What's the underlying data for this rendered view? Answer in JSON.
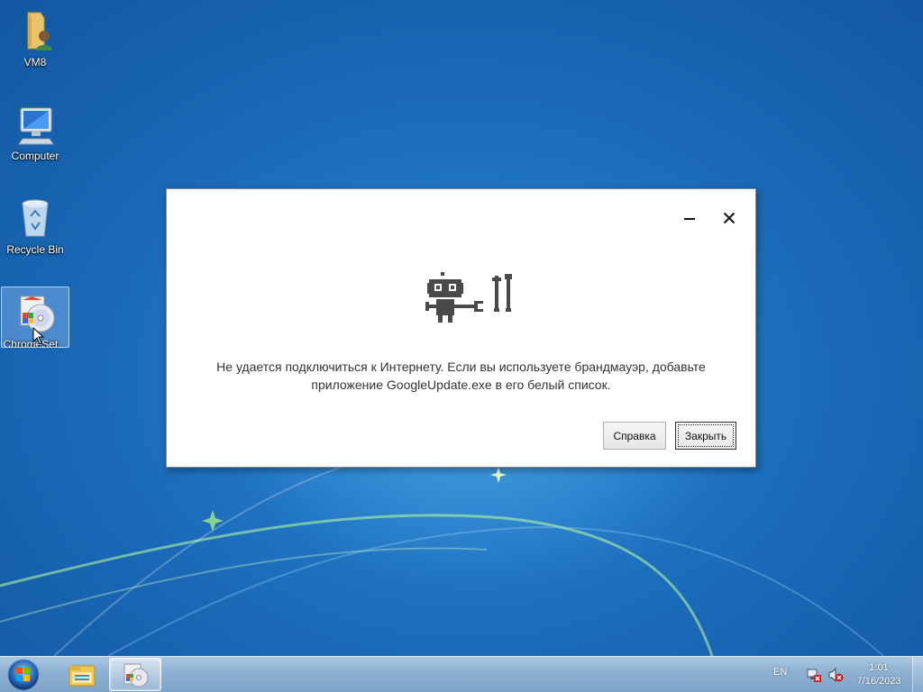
{
  "desktop": {
    "icons": [
      {
        "label": "VM8",
        "icon": "user-folder-icon"
      },
      {
        "label": "Computer",
        "icon": "computer-icon"
      },
      {
        "label": "Recycle Bin",
        "icon": "recycle-bin-icon"
      },
      {
        "label": "ChromeSet...",
        "icon": "setup-installer-icon",
        "selected": true
      }
    ]
  },
  "dialog": {
    "illustration": "offline-robot-icon",
    "message_line1": "Не удается подключиться к Интернету. Если вы используете брандмауэр, добавьте",
    "message_line2": "приложение GoogleUpdate.exe в его белый список.",
    "help_label": "Справка",
    "close_label": "Закрыть"
  },
  "taskbar": {
    "language": "EN",
    "time": "1:01",
    "date": "7/16/2023"
  },
  "colors": {
    "desktop_blue": "#1a6ab8",
    "robot_gray": "#4a4a4a",
    "dialog_bg": "#ffffff"
  }
}
